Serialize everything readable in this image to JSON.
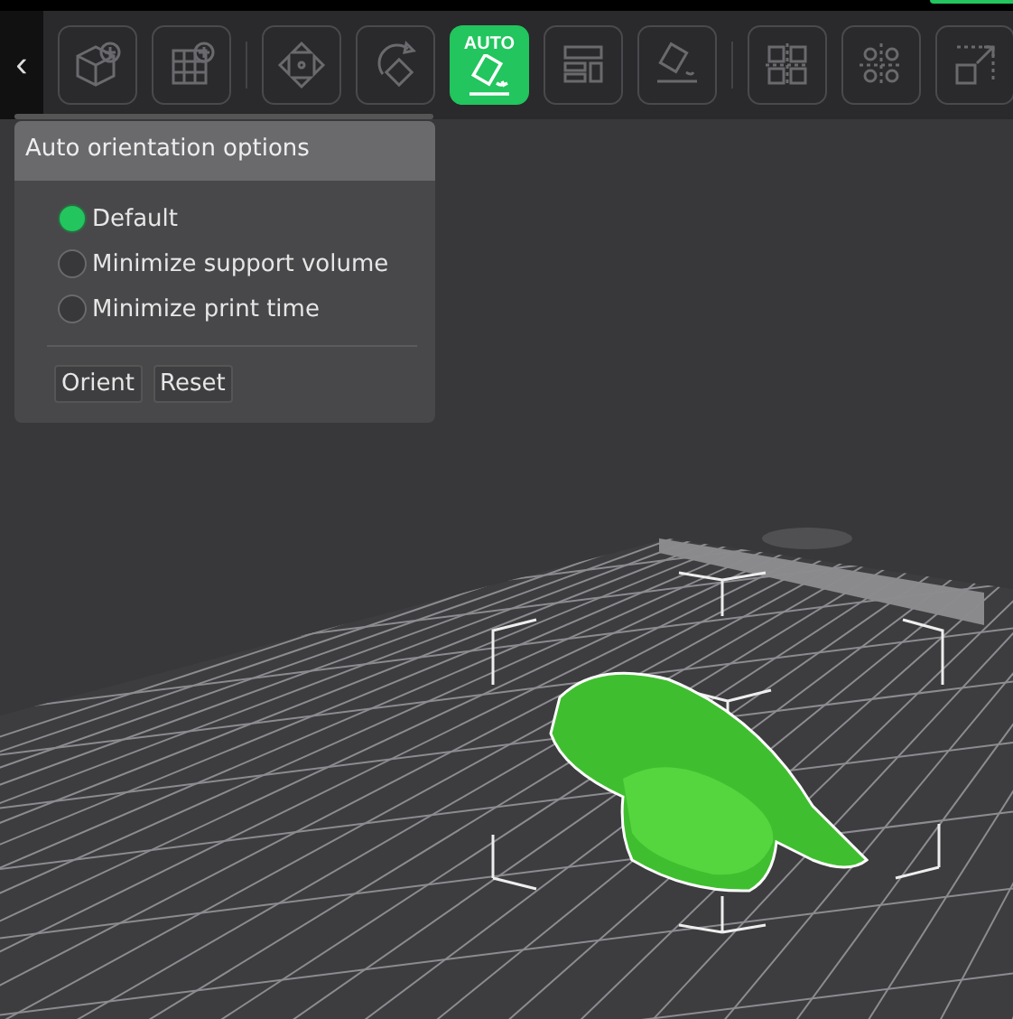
{
  "toolbar": {
    "collapse_glyph": "‹",
    "tools": [
      {
        "kind": "add-model",
        "selected": false
      },
      {
        "kind": "add-plate",
        "selected": false
      },
      {
        "kind": "move",
        "selected": false
      },
      {
        "kind": "rotate",
        "selected": false
      },
      {
        "kind": "auto-orient",
        "label": "AUTO",
        "selected": true
      },
      {
        "kind": "arrange",
        "selected": false
      },
      {
        "kind": "lay-flat",
        "selected": false
      },
      {
        "kind": "split",
        "selected": false
      },
      {
        "kind": "settings-grid",
        "selected": false
      },
      {
        "kind": "scale",
        "selected": false
      }
    ]
  },
  "orientation_panel": {
    "title": "Auto orientation options",
    "options": [
      {
        "label": "Default",
        "selected": true
      },
      {
        "label": "Minimize support volume",
        "selected": false
      },
      {
        "label": "Minimize print time",
        "selected": false
      }
    ],
    "buttons": [
      "Orient",
      "Reset"
    ]
  }
}
